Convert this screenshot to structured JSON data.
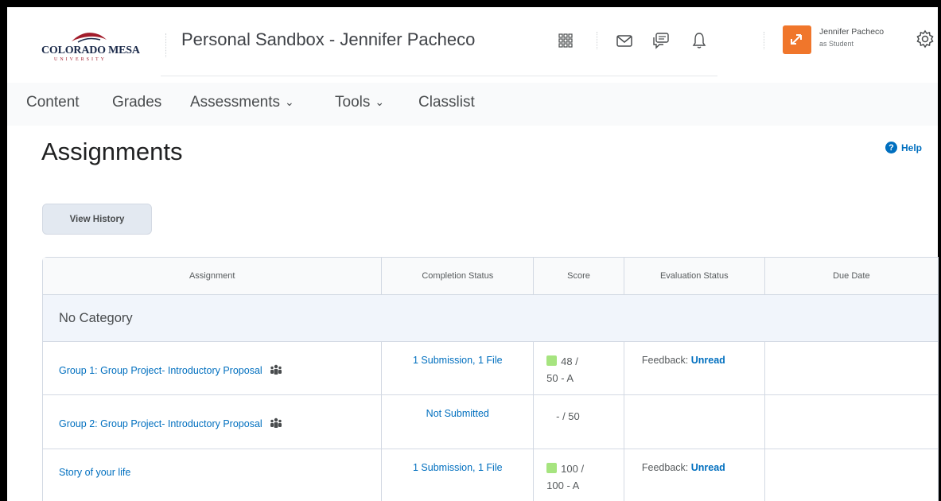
{
  "header": {
    "logo_text": "COLORADO MESA",
    "logo_subtext": "UNIVERSITY",
    "course_title": "Personal Sandbox - Jennifer Pacheco",
    "icons": [
      "grid-icon",
      "mail-icon",
      "chat-icon",
      "bell-icon"
    ],
    "user_name": "Jennifer Pacheco",
    "user_role": "as Student",
    "badge_color": "#f0762b"
  },
  "nav": {
    "content": "Content",
    "grades": "Grades",
    "assessments": "Assessments",
    "tools": "Tools",
    "classlist": "Classlist"
  },
  "page": {
    "title": "Assignments",
    "help_label": "Help",
    "view_history_label": "View History"
  },
  "table": {
    "columns": [
      "Assignment",
      "Completion Status",
      "Score",
      "Evaluation Status",
      "Due Date"
    ],
    "category": "No Category",
    "rows": [
      {
        "assignment": "Group 1: Group Project- Introductory Proposal",
        "completion": "1 Submission, 1 File",
        "score_line1": "48 /",
        "score_line2": "50 - A",
        "feedback_label": "Feedback: ",
        "feedback_value": "Unread",
        "due_date": ""
      },
      {
        "assignment": "Group 2: Group Project- Introductory Proposal",
        "completion": "Not Submitted",
        "score_line1": "- / 50",
        "score_line2": "",
        "feedback_label": "",
        "feedback_value": "",
        "due_date": ""
      },
      {
        "assignment": "Story of your life",
        "completion": "1 Submission, 1 File",
        "score_line1": "100 /",
        "score_line2": "100 - A",
        "feedback_label": "Feedback: ",
        "feedback_value": "Unread",
        "due_date": ""
      }
    ]
  },
  "colors": {
    "link": "#006fbf",
    "score_indicator": "#a6e47f"
  }
}
